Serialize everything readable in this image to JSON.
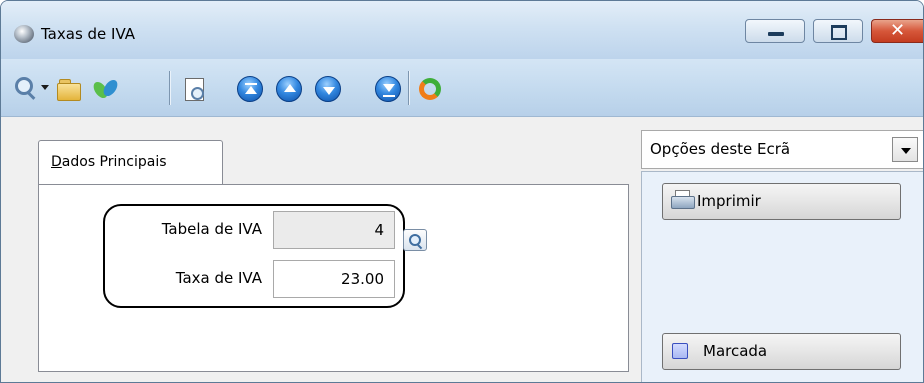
{
  "window": {
    "title": "Taxas de IVA"
  },
  "toolbar": {
    "icons": [
      "search-icon",
      "open-folder-icon",
      "recycle-icon",
      "print-preview-icon",
      "first-record-icon",
      "previous-record-icon",
      "next-record-icon",
      "last-record-icon",
      "refresh-icon"
    ]
  },
  "tab": {
    "label_accel": "D",
    "label_rest": "ados Principais"
  },
  "form": {
    "tabela_label": "Tabela de IVA",
    "tabela_value": "4",
    "taxa_label": "Taxa de IVA",
    "taxa_value": "23.00"
  },
  "options": {
    "selected": "Opções deste Ecrã",
    "print_label": "Imprimir",
    "mark_label": "Marcada"
  },
  "colors": {
    "toolbar_bg": "#c5dbef",
    "close_button": "#d6573a",
    "options_panel_bg": "#e9f1fa"
  }
}
